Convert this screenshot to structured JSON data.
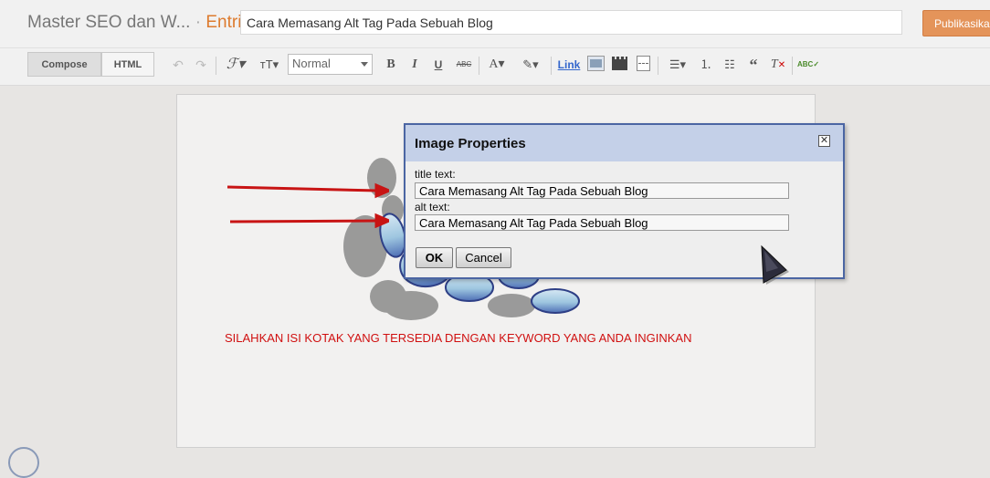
{
  "header": {
    "blog_name": "Master SEO dan W...",
    "separator": "·",
    "section": "Entri",
    "post_title": "Cara Memasang Alt Tag Pada Sebuah Blog",
    "publish_label": "Publikasika"
  },
  "toolbar": {
    "compose_label": "Compose",
    "html_label": "HTML",
    "font_style_value": "Normal",
    "link_label": "Link",
    "bold_glyph": "B",
    "italic_glyph": "I",
    "underline_glyph": "U",
    "strike_glyph": "ABC"
  },
  "editor": {
    "instruction": "SILAHKAN ISI KOTAK YANG TERSEDIA DENGAN KEYWORD YANG ANDA INGINKAN"
  },
  "dialog": {
    "title": "Image Properties",
    "title_text_label": "title text:",
    "title_text_value": "Cara Memasang Alt Tag Pada Sebuah Blog",
    "alt_text_label": "alt text:",
    "alt_text_value": "Cara Memasang Alt Tag Pada Sebuah Blog",
    "ok_label": "OK",
    "cancel_label": "Cancel",
    "close_glyph": "✕"
  },
  "colors": {
    "accent_orange": "#dd7b2e",
    "publish_bg": "#e4945a",
    "dialog_header": "#c4d0e8",
    "dialog_border": "#4b65a3",
    "annotation_red": "#d01010"
  },
  "icons": [
    "undo-icon",
    "redo-icon",
    "font-family-icon",
    "font-size-icon",
    "text-color-icon",
    "highlight-icon",
    "image-icon",
    "video-icon",
    "jump-break-icon",
    "align-icon",
    "numbered-list-icon",
    "bullet-list-icon",
    "quote-icon",
    "clear-format-icon",
    "spellcheck-icon",
    "mouse-cursor-icon"
  ]
}
